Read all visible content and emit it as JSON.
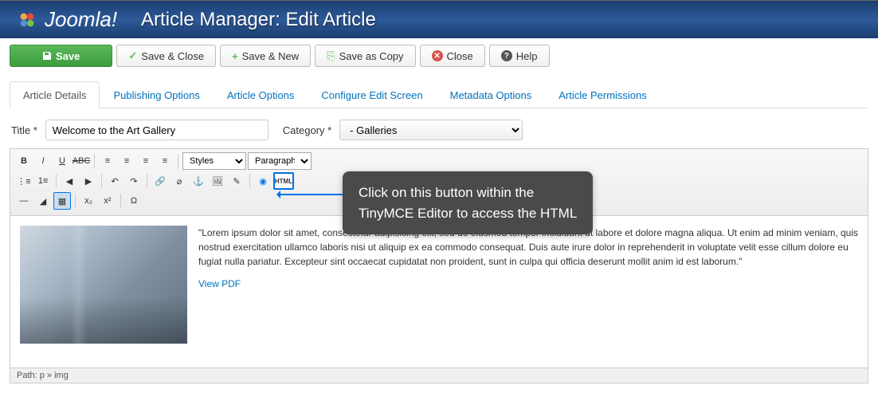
{
  "header": {
    "brand": "Joomla!",
    "title": "Article Manager: Edit Article"
  },
  "toolbar": {
    "save": "Save",
    "saveClose": "Save & Close",
    "saveNew": "Save & New",
    "saveCopy": "Save as Copy",
    "close": "Close",
    "help": "Help"
  },
  "tabs": [
    {
      "label": "Article Details"
    },
    {
      "label": "Publishing Options"
    },
    {
      "label": "Article Options"
    },
    {
      "label": "Configure Edit Screen"
    },
    {
      "label": "Metadata Options"
    },
    {
      "label": "Article Permissions"
    }
  ],
  "form": {
    "titleLabel": "Title *",
    "titleValue": "Welcome to the Art Gallery",
    "categoryLabel": "Category *",
    "categoryValue": "- Galleries"
  },
  "editor": {
    "stylesLabel": "Styles",
    "paragraphLabel": "Paragraph",
    "htmlBtn": "HTML"
  },
  "callout": {
    "line1": "Click on this button within the",
    "line2": "TinyMCE Editor to access the HTML"
  },
  "content": {
    "text": "\"Lorem ipsum dolor sit amet, consectetur adipisicing elit, sed do eiusmod tempor incididunt ut labore et dolore magna aliqua. Ut enim ad minim veniam, quis nostrud exercitation ullamco laboris nisi ut aliquip ex ea commodo consequat. Duis aute irure dolor in reprehenderit in voluptate velit esse cillum dolore eu fugiat nulla pariatur. Excepteur sint occaecat cupidatat non proident, sunt in culpa qui officia deserunt mollit anim id est laborum.\"",
    "link": "View PDF"
  },
  "footer": {
    "path": "Path: p » img"
  }
}
